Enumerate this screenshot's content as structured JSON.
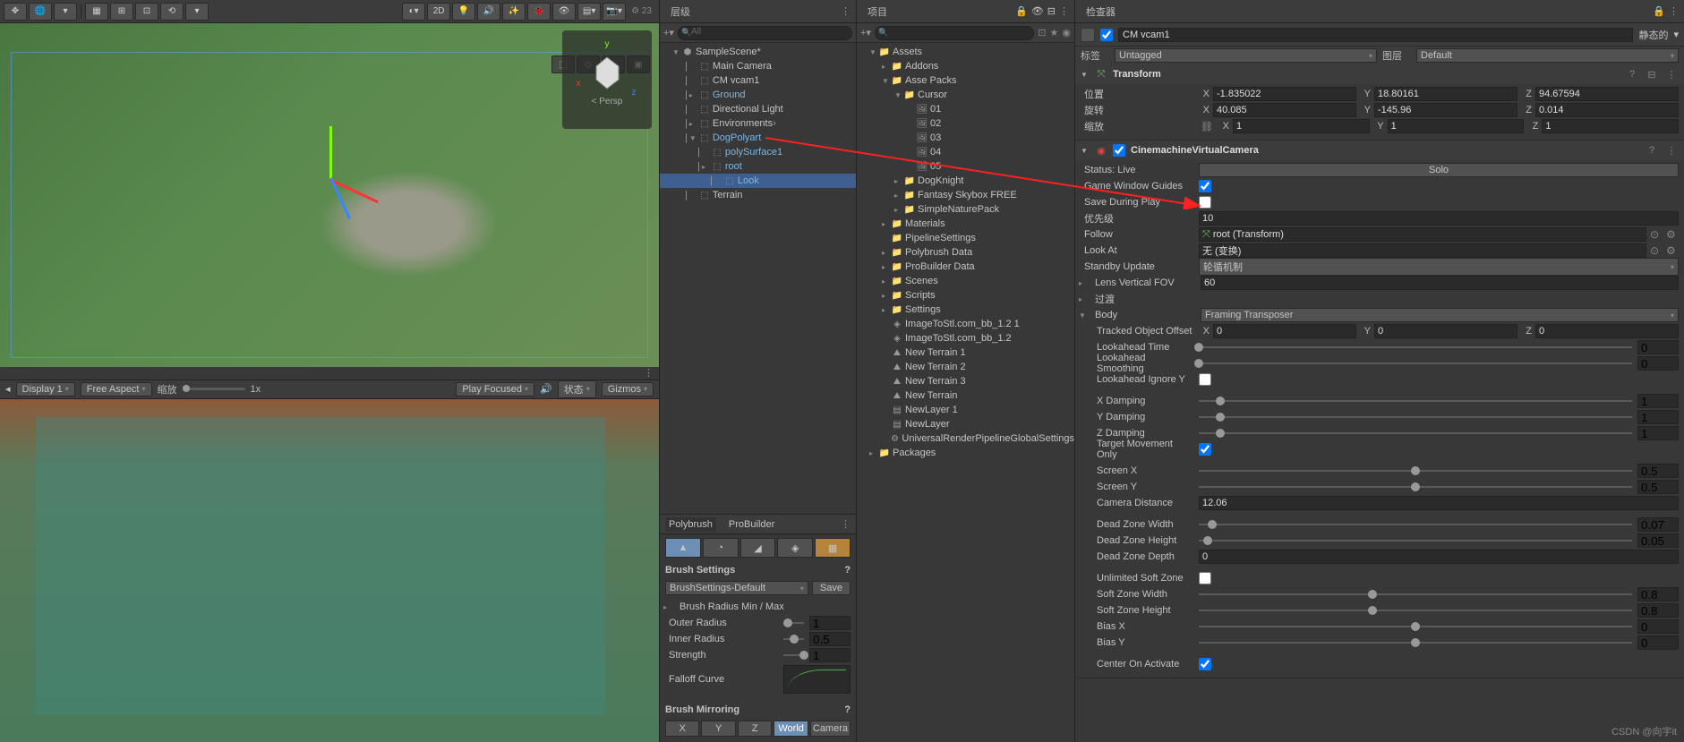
{
  "scene_toolbar": {
    "right_count": "23",
    "mode_2d": "2D",
    "persp": "< Persp"
  },
  "hierarchy": {
    "search_placeholder": "All",
    "root": "SampleScene*",
    "items": [
      {
        "label": "Main Camera",
        "indent": 2
      },
      {
        "label": "CM vcam1",
        "indent": 2
      },
      {
        "label": "Ground",
        "indent": 2,
        "prefab": true,
        "expandable": true
      },
      {
        "label": "Directional Light",
        "indent": 2
      },
      {
        "label": "Environments",
        "indent": 2,
        "expandable": true,
        "proxy": true
      },
      {
        "label": "DogPolyart",
        "indent": 2,
        "prefab": true,
        "expanded": true
      },
      {
        "label": "polySurface1",
        "indent": 3,
        "prefab": true
      },
      {
        "label": "root",
        "indent": 3,
        "prefab": true,
        "expandable": true
      },
      {
        "label": "Look",
        "indent": 4,
        "prefab": true,
        "selected": true
      },
      {
        "label": "Terrain",
        "indent": 2
      }
    ]
  },
  "project": {
    "assets": "Assets",
    "items": [
      {
        "label": "Addons",
        "indent": 2,
        "expandable": true
      },
      {
        "label": "Asse Packs",
        "indent": 2,
        "expanded": true
      },
      {
        "label": "Cursor",
        "indent": 3,
        "expanded": true
      },
      {
        "label": "01",
        "indent": 4,
        "icon": "image"
      },
      {
        "label": "02",
        "indent": 4,
        "icon": "image"
      },
      {
        "label": "03",
        "indent": 4,
        "icon": "image"
      },
      {
        "label": "04",
        "indent": 4,
        "icon": "image"
      },
      {
        "label": "05",
        "indent": 4,
        "icon": "image"
      },
      {
        "label": "DogKnight",
        "indent": 3,
        "expandable": true
      },
      {
        "label": "Fantasy Skybox FREE",
        "indent": 3,
        "expandable": true
      },
      {
        "label": "SimpleNaturePack",
        "indent": 3,
        "expandable": true
      },
      {
        "label": "Materials",
        "indent": 2,
        "expandable": true
      },
      {
        "label": "PipelineSettings",
        "indent": 2
      },
      {
        "label": "Polybrush Data",
        "indent": 2,
        "expandable": true
      },
      {
        "label": "ProBuilder Data",
        "indent": 2,
        "expandable": true
      },
      {
        "label": "Scenes",
        "indent": 2,
        "expandable": true
      },
      {
        "label": "Scripts",
        "indent": 2,
        "expandable": true
      },
      {
        "label": "Settings",
        "indent": 2,
        "expandable": true
      },
      {
        "label": "ImageToStl.com_bb_1.2 1",
        "indent": 2,
        "icon": "mesh"
      },
      {
        "label": "ImageToStl.com_bb_1.2",
        "indent": 2,
        "icon": "mesh"
      },
      {
        "label": "New Terrain 1",
        "indent": 2,
        "icon": "terrain"
      },
      {
        "label": "New Terrain 2",
        "indent": 2,
        "icon": "terrain"
      },
      {
        "label": "New Terrain 3",
        "indent": 2,
        "icon": "terrain"
      },
      {
        "label": "New Terrain",
        "indent": 2,
        "icon": "terrain"
      },
      {
        "label": "NewLayer 1",
        "indent": 2,
        "icon": "layer"
      },
      {
        "label": "NewLayer",
        "indent": 2,
        "icon": "layer"
      },
      {
        "label": "UniversalRenderPipelineGlobalSettings",
        "indent": 2,
        "icon": "asset"
      }
    ],
    "packages": "Packages"
  },
  "game": {
    "display": "Display 1",
    "aspect": "Free Aspect",
    "scale_label": "缩放",
    "scale_value": "1x",
    "play_mode": "Play Focused",
    "state_label": "状态",
    "gizmos_label": "Gizmos"
  },
  "inspector": {
    "name": "CM vcam1",
    "static_label": "静态的",
    "tag_label": "标签",
    "tag_value": "Untagged",
    "layer_label": "图层",
    "layer_value": "Default",
    "transform": {
      "title": "Transform",
      "pos_label": "位置",
      "rot_label": "旋转",
      "scale_label": "缩放",
      "pos": {
        "x": "-1.835022",
        "y": "18.80161",
        "z": "94.67594"
      },
      "rot": {
        "x": "40.085",
        "y": "-145.96",
        "z": "0.014"
      },
      "scale": {
        "x": "1",
        "y": "1",
        "z": "1"
      }
    },
    "vcam": {
      "title": "CinemachineVirtualCamera",
      "status_label": "Status: Live",
      "solo": "Solo",
      "guides_label": "Game Window Guides",
      "save_label": "Save During Play",
      "priority_label": "优先级",
      "priority": "10",
      "follow_label": "Follow",
      "follow_value": "root (Transform)",
      "lookat_label": "Look At",
      "lookat_value": "无 (变换)",
      "standby_label": "Standby Update",
      "standby_value": "轮循机制",
      "fov_label": "Lens Vertical FOV",
      "fov": "60",
      "transitions_label": "过渡",
      "body_label": "Body",
      "body_value": "Framing Transposer",
      "tracked_label": "Tracked Object Offset",
      "tracked": {
        "x": "0",
        "y": "0",
        "z": "0"
      },
      "lookahead_time": {
        "label": "Lookahead Time",
        "value": "0"
      },
      "lookahead_smoothing": {
        "label": "Lookahead Smoothing",
        "value": "0"
      },
      "lookahead_ignore": {
        "label": "Lookahead Ignore Y"
      },
      "x_damping": {
        "label": "X Damping",
        "value": "1"
      },
      "y_damping": {
        "label": "Y Damping",
        "value": "1"
      },
      "z_damping": {
        "label": "Z Damping",
        "value": "1"
      },
      "target_movement": {
        "label": "Target Movement Only"
      },
      "screen_x": {
        "label": "Screen X",
        "value": "0.5"
      },
      "screen_y": {
        "label": "Screen Y",
        "value": "0.5"
      },
      "camera_distance": {
        "label": "Camera Distance",
        "value": "12.06"
      },
      "dead_width": {
        "label": "Dead Zone Width",
        "value": "0.07"
      },
      "dead_height": {
        "label": "Dead Zone Height",
        "value": "0.05"
      },
      "dead_depth": {
        "label": "Dead Zone Depth",
        "value": "0"
      },
      "unlimited_soft": {
        "label": "Unlimited Soft Zone"
      },
      "soft_width": {
        "label": "Soft Zone Width",
        "value": "0.8"
      },
      "soft_height": {
        "label": "Soft Zone Height",
        "value": "0.8"
      },
      "bias_x": {
        "label": "Bias X",
        "value": "0"
      },
      "bias_y": {
        "label": "Bias Y",
        "value": "0"
      },
      "center_activate": {
        "label": "Center On Activate"
      }
    }
  },
  "polybrush": {
    "tab1": "Polybrush",
    "tab2": "ProBuilder",
    "settings_title": "Brush Settings",
    "preset": "BrushSettings-Default",
    "save": "Save",
    "radius_label": "Brush Radius Min / Max",
    "outer_radius": {
      "label": "Outer Radius",
      "value": "1"
    },
    "inner_radius": {
      "label": "Inner Radius",
      "value": "0.5"
    },
    "strength": {
      "label": "Strength",
      "value": "1"
    },
    "falloff_label": "Falloff Curve",
    "mirroring_title": "Brush Mirroring",
    "mirror_btns": [
      "X",
      "Y",
      "Z",
      "World",
      "Camera"
    ]
  },
  "watermark": "CSDN @向宇it"
}
